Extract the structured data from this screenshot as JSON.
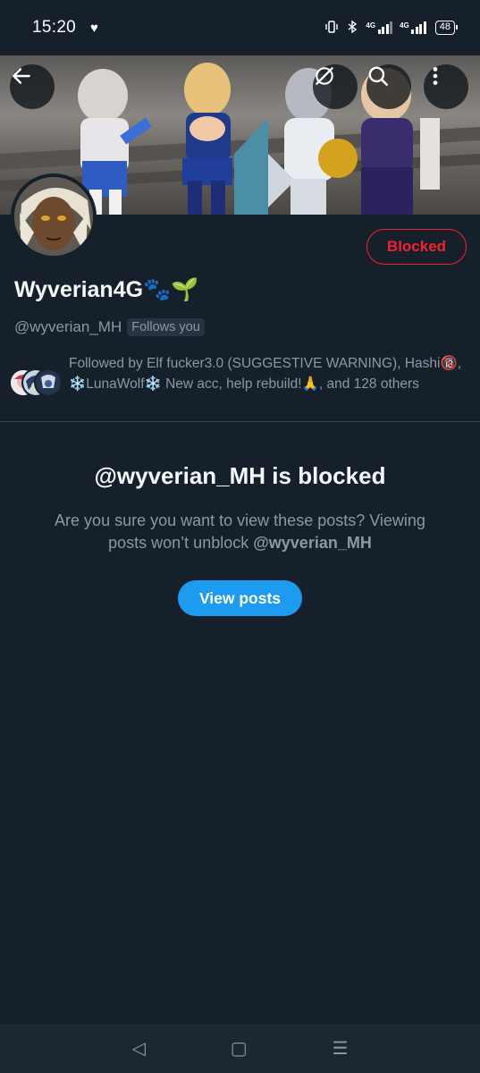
{
  "status_bar": {
    "time": "15:20",
    "left_icon": "heart-icon",
    "right_icons": [
      "vibrate-icon",
      "bluetooth-icon",
      "signal-4g-icon",
      "signal-4g-icon"
    ],
    "network_label_1": "4G",
    "network_label_2": "4G",
    "battery": "48"
  },
  "header": {
    "back_icon": "arrow-left-icon",
    "action_icons": [
      "no-spread-icon",
      "search-icon",
      "more-vertical-icon"
    ]
  },
  "profile": {
    "display_name": "Wyverian4G🐾🌱",
    "handle": "@wyverian_MH",
    "follows_you": "Follows you",
    "blocked_button": "Blocked",
    "followers_text": "Followed by Elf fucker3.0 (SUGGESTIVE WARNING), Hashi🔞, ❄️LunaWolf❄️ New acc, help rebuild!🙏, and 128 others"
  },
  "blocked": {
    "title": "@wyverian_MH is blocked",
    "subtitle_prefix": "Are you sure you want to view these posts? Viewing posts won’t unblock ",
    "subtitle_handle": "@wyverian_MH",
    "view_button": "View posts"
  },
  "nav": {
    "back": "◁",
    "home": "▢",
    "recents": "☰"
  },
  "colors": {
    "background": "#15202b",
    "accent": "#1d9bf0",
    "danger": "#f4212e",
    "secondary_text": "#8b98a5"
  }
}
